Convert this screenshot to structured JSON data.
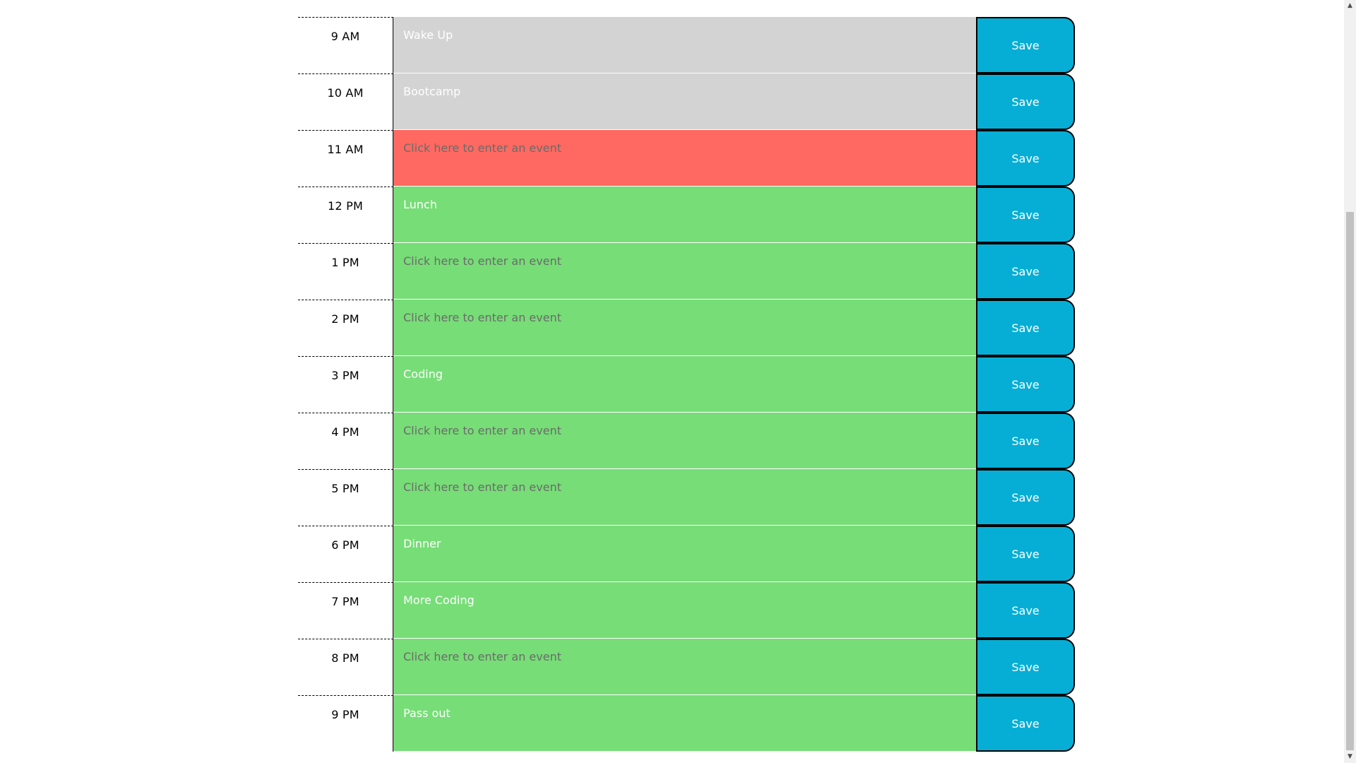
{
  "planner": {
    "save_label": "Save",
    "rows": [
      {
        "hour": "9 AM",
        "value": "Wake Up",
        "placeholder": "Click here to enter an event",
        "state": "past"
      },
      {
        "hour": "10 AM",
        "value": "Bootcamp",
        "placeholder": "Click here to enter an event",
        "state": "past"
      },
      {
        "hour": "11 AM",
        "value": "",
        "placeholder": "Click here to enter an event",
        "state": "present"
      },
      {
        "hour": "12 PM",
        "value": "Lunch",
        "placeholder": "Click here to enter an event",
        "state": "future"
      },
      {
        "hour": "1 PM",
        "value": "",
        "placeholder": "Click here to enter an event",
        "state": "future"
      },
      {
        "hour": "2 PM",
        "value": "",
        "placeholder": "Click here to enter an event",
        "state": "future"
      },
      {
        "hour": "3 PM",
        "value": "Coding",
        "placeholder": "Click here to enter an event",
        "state": "future"
      },
      {
        "hour": "4 PM",
        "value": "",
        "placeholder": "Click here to enter an event",
        "state": "future"
      },
      {
        "hour": "5 PM",
        "value": "",
        "placeholder": "Click here to enter an event",
        "state": "future"
      },
      {
        "hour": "6 PM",
        "value": "Dinner",
        "placeholder": "Click here to enter an event",
        "state": "future"
      },
      {
        "hour": "7 PM",
        "value": "More Coding",
        "placeholder": "Click here to enter an event",
        "state": "future"
      },
      {
        "hour": "8 PM",
        "value": "",
        "placeholder": "Click here to enter an event",
        "state": "future"
      },
      {
        "hour": "9 PM",
        "value": "Pass out",
        "placeholder": "Click here to enter an event",
        "state": "future"
      }
    ]
  },
  "colors": {
    "past": "#d3d3d3",
    "present": "#ff6961",
    "future": "#77dd77",
    "save_button": "#06aed5"
  },
  "icons": {
    "scroll_up": "triangle-up-icon",
    "scroll_down": "triangle-down-icon"
  }
}
